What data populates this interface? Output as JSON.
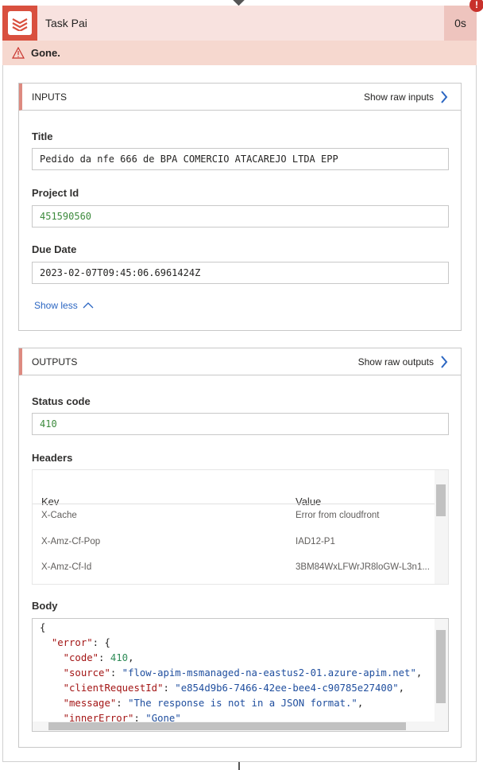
{
  "header": {
    "title": "Task Pai",
    "duration": "0s",
    "error_badge": "!",
    "icon": "todoist-icon",
    "accent": "#d9503f"
  },
  "status": {
    "message": "Gone.",
    "icon": "warning-triangle-icon"
  },
  "inputs": {
    "heading": "INPUTS",
    "raw_label": "Show raw inputs",
    "fields": [
      {
        "label": "Title",
        "value": "Pedido da nfe 666 de BPA COMERCIO ATACAREJO LTDA EPP"
      },
      {
        "label": "Project Id",
        "value": "451590560"
      },
      {
        "label": "Due Date",
        "value": "2023-02-07T09:45:06.6961424Z"
      }
    ],
    "show_less": "Show less"
  },
  "outputs": {
    "heading": "OUTPUTS",
    "raw_label": "Show raw outputs",
    "status_label": "Status code",
    "status_value": "410",
    "headers_label": "Headers",
    "headers_columns": [
      "Kev",
      "Value"
    ],
    "headers_rows": [
      {
        "key": "X-Cache",
        "value": "Error from cloudfront"
      },
      {
        "key": "X-Amz-Cf-Pop",
        "value": "IAD12-P1"
      },
      {
        "key": "X-Amz-Cf-Id",
        "value": "3BM84WxLFWrJR8loGW-L3n1..."
      }
    ],
    "body_label": "Body",
    "body": {
      "code": "410",
      "source": "flow-apim-msmanaged-na-eastus2-01.azure-apim.net",
      "clientRequestId": "e854d9b6-7466-42ee-bee4-c90785e27400",
      "message": "The response is not in a JSON format.",
      "innerError": "Gone"
    }
  }
}
